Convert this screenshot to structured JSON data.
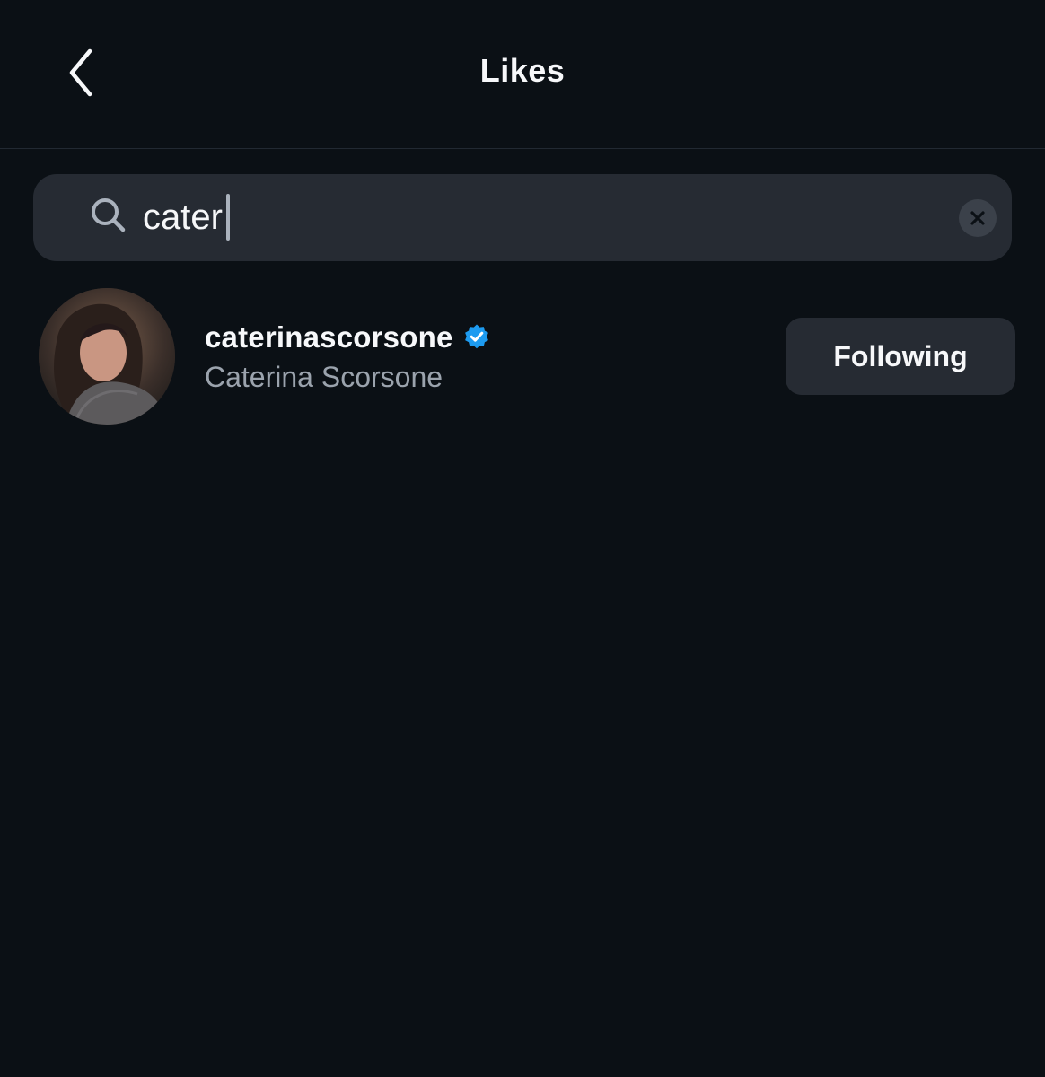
{
  "header": {
    "title": "Likes",
    "back_icon": "chevron-left-icon"
  },
  "search": {
    "value": "cater",
    "search_icon": "search-icon",
    "clear_icon": "close-icon"
  },
  "results": [
    {
      "username": "caterinascorsone",
      "full_name": "Caterina Scorsone",
      "verified": true,
      "verified_color": "#1d9bf0",
      "button_label": "Following"
    }
  ],
  "colors": {
    "background": "#0b1015",
    "surface": "#262b33",
    "text_primary": "#f7f8fa",
    "text_secondary": "#9ba3ad"
  }
}
